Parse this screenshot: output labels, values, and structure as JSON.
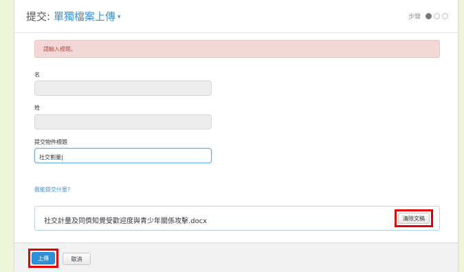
{
  "header": {
    "title_prefix": "提交: ",
    "title_accent": "單獨檔案上傳",
    "caret": "▾",
    "steps_label": "步驟"
  },
  "error_message": "請輸入標題。",
  "form": {
    "first_name_label": "名",
    "first_name_value": "",
    "last_name_label": "姓",
    "last_name_value": "",
    "title_label": "提交物件標題",
    "title_value": "社交割量|"
  },
  "help_link": "我能提交什麼?",
  "file": {
    "name": "社交計量及同儕知覺受歡迎度與青少年關係攻擊.docx",
    "clear_label": "清除文稿"
  },
  "footer": {
    "upload_label": "上傳",
    "cancel_label": "取消"
  },
  "colors": {
    "accent": "#3a8fd6",
    "error_bg": "#f3d8d8",
    "highlight": "#e00000",
    "primary_button": "#2f8fd8"
  }
}
